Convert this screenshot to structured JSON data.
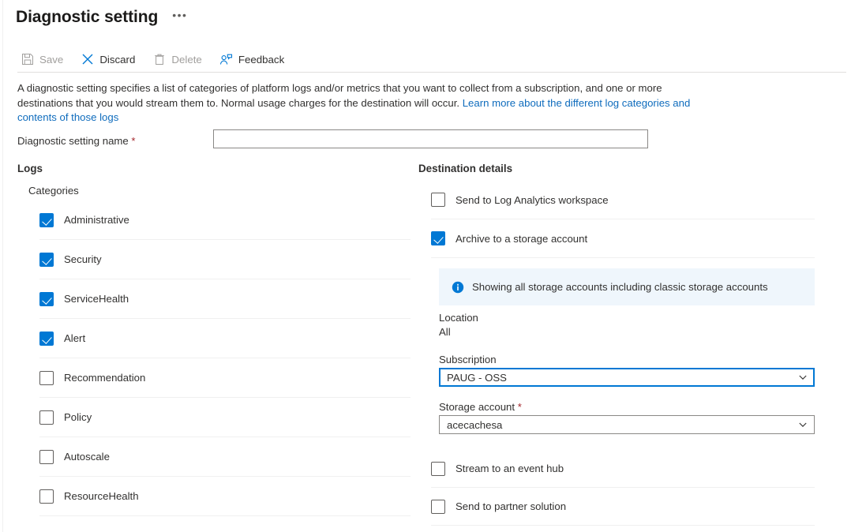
{
  "header": {
    "title": "Diagnostic setting",
    "more_label": "•••"
  },
  "toolbar": {
    "items": [
      {
        "label": "Save",
        "icon": "save-icon",
        "disabled": true
      },
      {
        "label": "Discard",
        "icon": "discard-icon",
        "disabled": false
      },
      {
        "label": "Delete",
        "icon": "delete-icon",
        "disabled": true
      },
      {
        "label": "Feedback",
        "icon": "feedback-icon",
        "disabled": false
      }
    ]
  },
  "description": {
    "text": "A diagnostic setting specifies a list of categories of platform logs and/or metrics that you want to collect from a subscription, and one or more destinations that you would stream them to. Normal usage charges for the destination will occur. ",
    "link_text": "Learn more about the different log categories and contents of those logs"
  },
  "name_field": {
    "label": "Diagnostic setting name",
    "required_marker": "*",
    "value": "",
    "placeholder": ""
  },
  "logs": {
    "heading": "Logs",
    "categories_heading": "Categories",
    "categories": [
      {
        "label": "Administrative",
        "checked": true
      },
      {
        "label": "Security",
        "checked": true
      },
      {
        "label": "ServiceHealth",
        "checked": true
      },
      {
        "label": "Alert",
        "checked": true
      },
      {
        "label": "Recommendation",
        "checked": false
      },
      {
        "label": "Policy",
        "checked": false
      },
      {
        "label": "Autoscale",
        "checked": false
      },
      {
        "label": "ResourceHealth",
        "checked": false
      }
    ]
  },
  "destination": {
    "heading": "Destination details",
    "options_top": [
      {
        "label": "Send to Log Analytics workspace",
        "checked": false
      },
      {
        "label": "Archive to a storage account",
        "checked": true
      }
    ],
    "info_banner": {
      "icon": "info-icon",
      "text": "Showing all storage accounts including classic storage accounts"
    },
    "location": {
      "label": "Location",
      "value": "All"
    },
    "subscription": {
      "label": "Subscription",
      "value": "PAUG - OSS",
      "focused": true
    },
    "storage_account": {
      "label": "Storage account",
      "required_marker": "*",
      "value": "acecachesa"
    },
    "options_bottom": [
      {
        "label": "Stream to an event hub",
        "checked": false
      },
      {
        "label": "Send to partner solution",
        "checked": false
      }
    ]
  },
  "colors": {
    "accent": "#0078d4",
    "link": "#0f6cbd",
    "required": "#a4262c",
    "info_bg": "#eff6fc",
    "disabled_text": "#a19f9d"
  }
}
